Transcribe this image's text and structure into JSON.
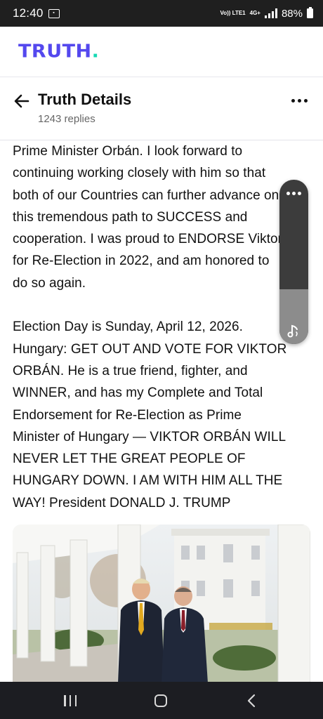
{
  "status_bar": {
    "time": "12:40",
    "notification_icon": "app-notification-icon",
    "network_volte": "Vo)) LTE1",
    "network_type": "4G+",
    "battery": "88%"
  },
  "app": {
    "logo_text": "TRUTH",
    "logo_dot": ".",
    "brand_color": "#5448ee",
    "accent_color": "#16d9b4"
  },
  "header": {
    "title": "Truth Details",
    "replies": "1243 replies",
    "back_icon": "arrow-left-icon",
    "more_icon": "more-horizontal-icon"
  },
  "post": {
    "paragraph_1": "Prime Minister Orbán. I look forward to\ncontinuing working closely with him so that\nboth of our Countries can further advance on\nthis tremendous path to SUCCESS and\ncooperation. I was proud to ENDORSE Viktor\nfor Re-Election in 2022, and am honored to\ndo so again.",
    "paragraph_2": "Election Day is Sunday, April 12, 2026.\nHungary: GET OUT AND VOTE FOR VIKTOR\nORBÁN. He is a true friend, fighter, and\nWINNER, and has my Complete and Total\nEndorsement for Re-Election as Prime\nMinister of Hungary — VIKTOR ORBÁN WILL\nNEVER LET THE GREAT PEOPLE OF\nHUNGARY DOWN. I AM WITH HIM ALL THE\nWAY! President DONALD J. TRUMP"
  },
  "floating_widget": {
    "menu_icon": "more-horizontal-icon",
    "music_icon": "music-note-icon"
  },
  "nav_bar": {
    "recents_icon": "recent-apps-icon",
    "home_icon": "home-icon",
    "back_icon": "chevron-left-icon"
  }
}
